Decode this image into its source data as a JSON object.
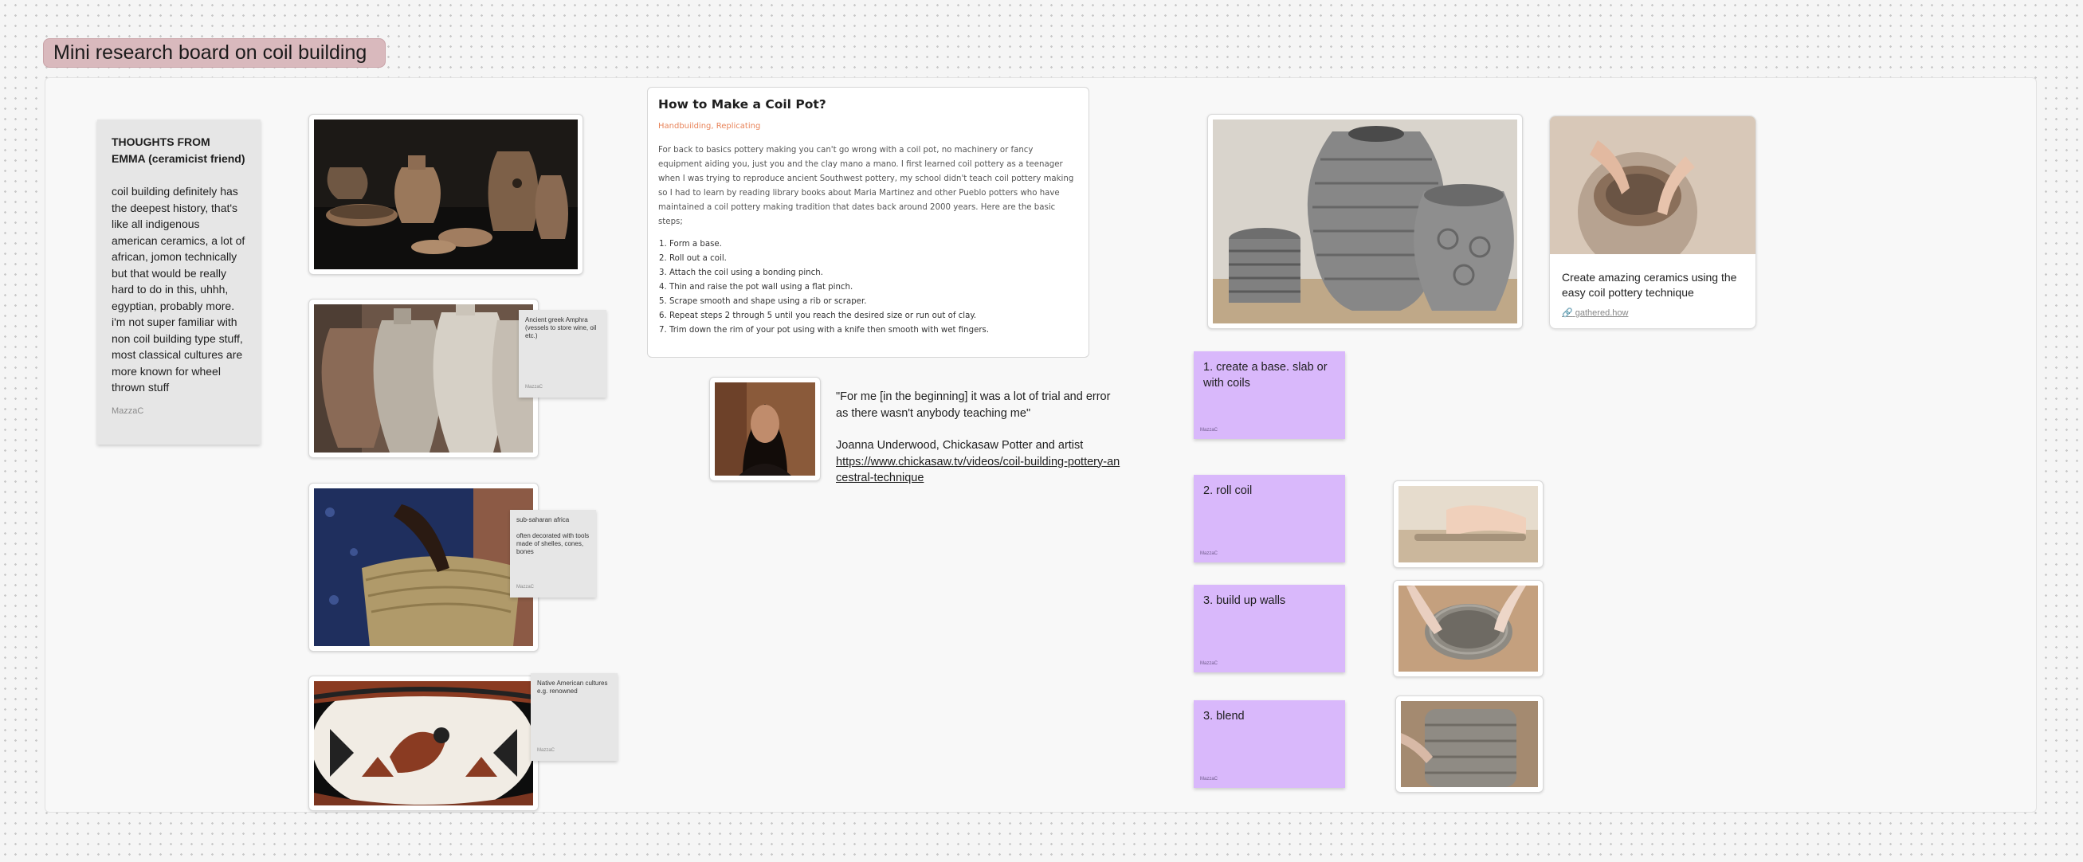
{
  "board_title": "Mini research board on coil building",
  "emma_note": {
    "title": "THOUGHTS FROM EMMA (ceramicist friend)",
    "body": "coil building definitely has the deepest history, that's like all indigenous american ceramics, a lot of african, jomon technically but that would be really hard to do in this, uhhh, egyptian, probably more. i'm not super familiar with non coil building type stuff, most classical cultures are more known for wheel thrown stuff",
    "author": "MazzaC"
  },
  "small_notes": [
    {
      "text": "Ancient greek Amphra (vessels to store wine, oil etc.)",
      "author": "MazzaC"
    },
    {
      "text": "sub-saharan africa",
      "text2": "often decorated with tools made of shelles, cones, bones",
      "author": "MazzaC"
    },
    {
      "text": "Native American cultures e.g. renowned",
      "author": "MazzaC"
    }
  ],
  "doc": {
    "title": "How to Make a Coil Pot?",
    "tags": "Handbuilding, Replicating",
    "body": "For back to basics pottery making you can't go wrong with a coil pot, no machinery or fancy equipment aiding you, just you and the clay mano a mano. I first learned coil pottery as a teenager when I was trying to reproduce ancient Southwest pottery, my school didn't teach coil pottery making so I had to learn by reading library books about Maria Martinez and other Pueblo potters who have maintained a coil pottery making tradition that dates back around 2000 years. Here are the basic steps;",
    "steps": [
      "Form a base.",
      "Roll out a coil.",
      "Attach the coil using a bonding pinch.",
      "Thin and raise the pot wall using a flat pinch.",
      "Scrape smooth and shape using a rib or scraper.",
      "Repeat steps 2 through 5 until you reach the desired size or run out of clay.",
      "Trim down the rim of your pot using with a knife then smooth with wet fingers."
    ]
  },
  "quote": {
    "text": "\"For me [in the beginning] it was a lot of trial and error as there wasn't anybody teaching me\"",
    "attribution": "Joanna Underwood, Chickasaw Potter and artist",
    "link": "https://www.chickasaw.tv/videos/coil-building-pottery-ancestral-technique"
  },
  "steps_notes": [
    {
      "text": "1. create a base. slab or with coils",
      "author": "MazzaC"
    },
    {
      "text": "2. roll coil",
      "author": "MazzaC"
    },
    {
      "text": "3. build up walls",
      "author": "MazzaC"
    },
    {
      "text": "3. blend",
      "author": "MazzaC"
    }
  ],
  "link_card": {
    "description": "Create amazing ceramics using the easy coil pottery technique",
    "url": "gathered.how"
  },
  "colors": {
    "title_bg": "#d9b9bd",
    "sticky_gray": "#e6e6e6",
    "sticky_purple": "#d9b8fb",
    "tag_orange": "#e8845a"
  }
}
